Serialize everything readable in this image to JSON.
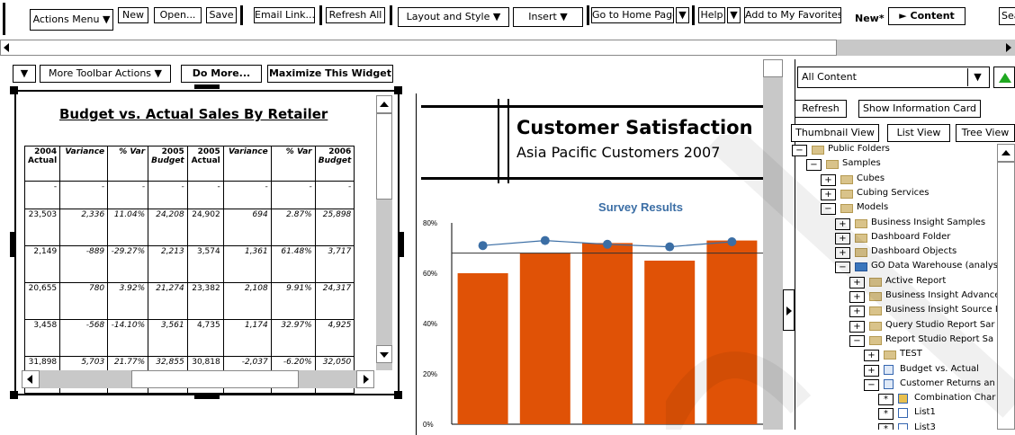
{
  "toolbar": {
    "actions_menu": "Actions Menu ▼",
    "new": "New",
    "open": "Open...",
    "save": "Save",
    "email_link": "Email Link...",
    "refresh_all": "Refresh All",
    "layout_style": "Layout and Style ▼",
    "insert": "Insert ▼",
    "go_home": "Go to Home Page",
    "help": "Help",
    "add_favorites": "Add to My Favorites",
    "doc_name": "New*",
    "content": "► Content",
    "search": "Sea"
  },
  "widget_toolbar": {
    "more_actions": "More Toolbar Actions ▼",
    "do_more": "Do More...",
    "maximize": "Maximize This Widget"
  },
  "budget": {
    "title": "Budget vs. Actual Sales By Retailer",
    "headers": [
      [
        "2004",
        "Actual"
      ],
      [
        "Variance",
        ""
      ],
      [
        "% Var",
        ""
      ],
      [
        "2005",
        "Budget"
      ],
      [
        "2005",
        "Actual"
      ],
      [
        "Variance",
        ""
      ],
      [
        "% Var",
        ""
      ],
      [
        "2006",
        "Budget"
      ]
    ],
    "rows": [
      [
        "-",
        "-",
        "-",
        "-",
        "-",
        "-",
        "-",
        "-"
      ],
      [
        "23,503",
        "2,336",
        "11.04%",
        "24,208",
        "24,902",
        "694",
        "2.87%",
        "25,898"
      ],
      [
        "2,149",
        "-889",
        "-29.27%",
        "2,213",
        "3,574",
        "1,361",
        "61.48%",
        "3,717"
      ],
      [
        "20,655",
        "780",
        "3.92%",
        "21,274",
        "23,382",
        "2,108",
        "9.91%",
        "24,317"
      ],
      [
        "3,458",
        "-568",
        "-14.10%",
        "3,561",
        "4,735",
        "1,174",
        "32.97%",
        "4,925"
      ],
      [
        "31,898",
        "5,703",
        "21.77%",
        "32,855",
        "30,818",
        "-2,037",
        "-6.20%",
        "32,050"
      ]
    ]
  },
  "satisfaction": {
    "title": "Customer Satisfaction",
    "subtitle": "Asia Pacific Customers 2007"
  },
  "chart_data": {
    "type": "bar",
    "title": "Survey Results",
    "categories": [
      "",
      "",
      "",
      "",
      ""
    ],
    "series": [
      {
        "values": [
          60,
          68,
          72,
          65,
          73
        ],
        "color": "#e05206"
      },
      {
        "values": [
          71,
          73,
          71.5,
          70.5,
          72.5
        ],
        "color": "#3b6ea5",
        "kind": "line"
      }
    ],
    "reference_line": 68,
    "ylim": [
      0,
      80
    ],
    "yticks": [
      "0%",
      "20%",
      "40%",
      "60%",
      "80%"
    ]
  },
  "right_panel": {
    "content_select": "All Content",
    "refresh": "Refresh",
    "show_info": "Show Information Card",
    "thumbnail_view": "Thumbnail View",
    "list_view": "List View",
    "tree_view": "Tree View"
  },
  "tree": [
    {
      "depth": 0,
      "toggle": "−",
      "icon": "folder",
      "label": "Public Folders"
    },
    {
      "depth": 1,
      "toggle": "−",
      "icon": "folder",
      "label": "Samples"
    },
    {
      "depth": 2,
      "toggle": "+",
      "icon": "folder",
      "label": "Cubes"
    },
    {
      "depth": 2,
      "toggle": "+",
      "icon": "folder",
      "label": "Cubing Services"
    },
    {
      "depth": 2,
      "toggle": "−",
      "icon": "folder",
      "label": "Models"
    },
    {
      "depth": 3,
      "toggle": "+",
      "icon": "folder",
      "label": "Business Insight Samples"
    },
    {
      "depth": 3,
      "toggle": "+",
      "icon": "folder",
      "label": "Dashboard Folder"
    },
    {
      "depth": 3,
      "toggle": "+",
      "icon": "folder",
      "label": "Dashboard Objects"
    },
    {
      "depth": 3,
      "toggle": "−",
      "icon": "package",
      "label": "GO Data Warehouse (analys"
    },
    {
      "depth": 4,
      "toggle": "+",
      "icon": "folder",
      "label": "Active Report"
    },
    {
      "depth": 4,
      "toggle": "+",
      "icon": "folder",
      "label": "Business Insight Advance"
    },
    {
      "depth": 4,
      "toggle": "+",
      "icon": "folder",
      "label": "Business Insight Source I"
    },
    {
      "depth": 4,
      "toggle": "+",
      "icon": "folder",
      "label": "Query Studio Report Sar"
    },
    {
      "depth": 4,
      "toggle": "−",
      "icon": "folder",
      "label": "Report Studio Report Sa"
    },
    {
      "depth": 5,
      "toggle": "+",
      "icon": "folder",
      "label": "TEST"
    },
    {
      "depth": 5,
      "toggle": "+",
      "icon": "report",
      "label": "Budget vs. Actual"
    },
    {
      "depth": 5,
      "toggle": "−",
      "icon": "report",
      "label": "Customer Returns an"
    },
    {
      "depth": 6,
      "toggle": "*",
      "icon": "chart",
      "label": "Combination Char"
    },
    {
      "depth": 6,
      "toggle": "*",
      "icon": "list",
      "label": "List1"
    },
    {
      "depth": 6,
      "toggle": "*",
      "icon": "list",
      "label": "List3"
    }
  ]
}
